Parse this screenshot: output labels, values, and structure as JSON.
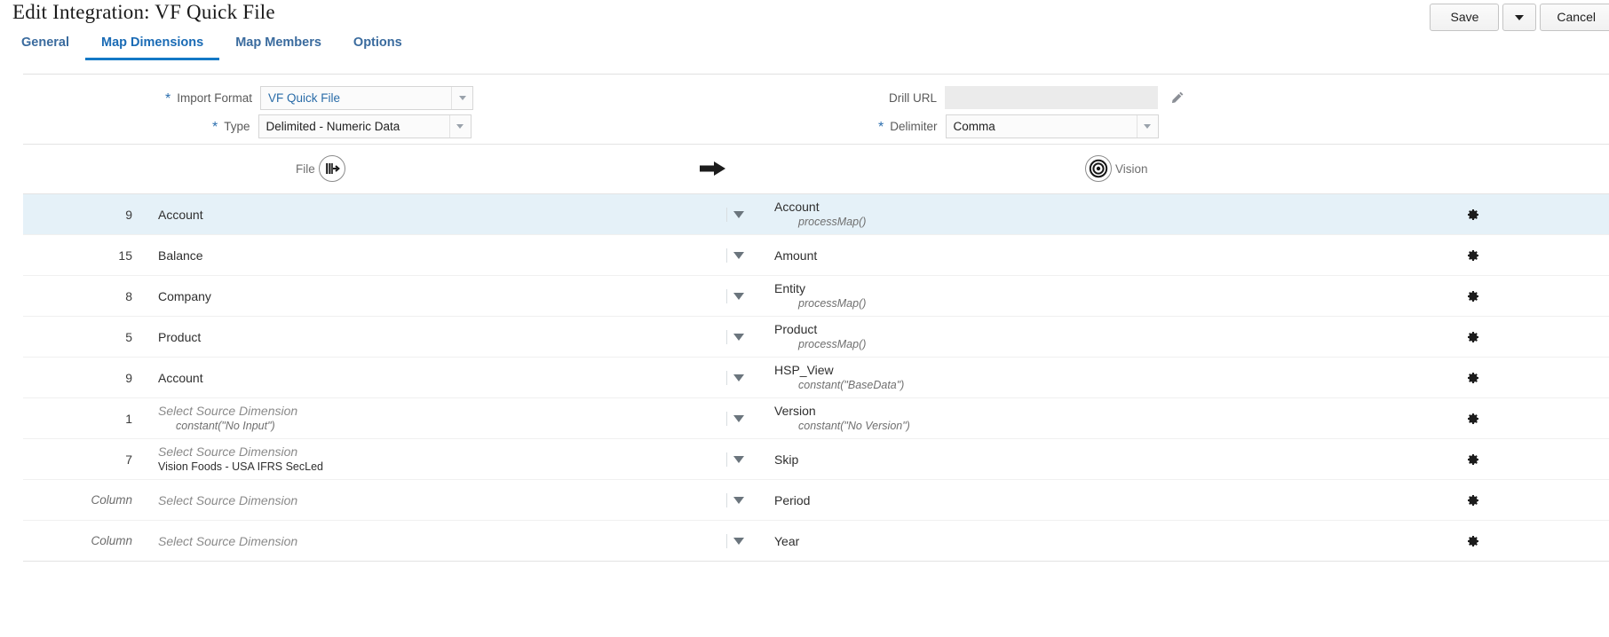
{
  "header": {
    "title": "Edit Integration: VF Quick File",
    "actions": {
      "save_label": "Save",
      "save_menu_icon": "chevron-down-icon",
      "cancel_label": "Cancel"
    }
  },
  "tabs": [
    {
      "label": "General",
      "active": false
    },
    {
      "label": "Map Dimensions",
      "active": true
    },
    {
      "label": "Map Members",
      "active": false
    },
    {
      "label": "Options",
      "active": false
    }
  ],
  "form": {
    "import_format": {
      "label": "Import Format",
      "required": true,
      "value": "VF Quick File",
      "dropdown_icon": "chevron-down-icon"
    },
    "type": {
      "label": "Type",
      "required": true,
      "value": "Delimited - Numeric Data",
      "dropdown_icon": "chevron-down-icon"
    },
    "drill_url": {
      "label": "Drill URL",
      "required": false,
      "value": "",
      "disabled": true,
      "edit_icon": "pencil-icon"
    },
    "delimiter": {
      "label": "Delimiter",
      "required": true,
      "value": "Comma",
      "dropdown_icon": "chevron-down-icon"
    }
  },
  "map_header": {
    "source_label": "File",
    "source_icon": "file-import-icon",
    "direction_icon": "arrow-right-icon",
    "target_label": "Vision",
    "target_icon": "target-bullseye-icon"
  },
  "mapping_rows": [
    {
      "column": "9",
      "column_italic": false,
      "source": "Account",
      "source_placeholder": false,
      "source_sub": "",
      "source_sub_italic": false,
      "target": "Account",
      "target_sub": "processMap()",
      "selected": true,
      "gear_icon": "gear-icon",
      "dropdown_icon": "caret-down-icon"
    },
    {
      "column": "15",
      "column_italic": false,
      "source": "Balance",
      "source_placeholder": false,
      "source_sub": "",
      "source_sub_italic": false,
      "target": "Amount",
      "target_sub": "",
      "selected": false,
      "gear_icon": "gear-icon",
      "dropdown_icon": "caret-down-icon"
    },
    {
      "column": "8",
      "column_italic": false,
      "source": "Company",
      "source_placeholder": false,
      "source_sub": "",
      "source_sub_italic": false,
      "target": "Entity",
      "target_sub": "processMap()",
      "selected": false,
      "gear_icon": "gear-icon",
      "dropdown_icon": "caret-down-icon"
    },
    {
      "column": "5",
      "column_italic": false,
      "source": "Product",
      "source_placeholder": false,
      "source_sub": "",
      "source_sub_italic": false,
      "target": "Product",
      "target_sub": "processMap()",
      "selected": false,
      "gear_icon": "gear-icon",
      "dropdown_icon": "caret-down-icon"
    },
    {
      "column": "9",
      "column_italic": false,
      "source": "Account",
      "source_placeholder": false,
      "source_sub": "",
      "source_sub_italic": false,
      "target": "HSP_View",
      "target_sub": "constant(\"BaseData\")",
      "selected": false,
      "gear_icon": "gear-icon",
      "dropdown_icon": "caret-down-icon"
    },
    {
      "column": "1",
      "column_italic": false,
      "source": "Select Source Dimension",
      "source_placeholder": true,
      "source_sub": "constant(\"No Input\")",
      "source_sub_italic": true,
      "target": "Version",
      "target_sub": "constant(\"No Version\")",
      "selected": false,
      "gear_icon": "gear-icon",
      "dropdown_icon": "caret-down-icon"
    },
    {
      "column": "7",
      "column_italic": false,
      "source": "Select Source Dimension",
      "source_placeholder": true,
      "source_sub": "Vision Foods - USA IFRS SecLed",
      "source_sub_italic": false,
      "target": "Skip",
      "target_sub": "",
      "selected": false,
      "gear_icon": "gear-icon",
      "dropdown_icon": "caret-down-icon"
    },
    {
      "column": "Column",
      "column_italic": true,
      "source": "Select Source Dimension",
      "source_placeholder": true,
      "source_sub": "",
      "source_sub_italic": false,
      "target": "Period",
      "target_sub": "",
      "selected": false,
      "gear_icon": "gear-icon",
      "dropdown_icon": "caret-down-icon"
    },
    {
      "column": "Column",
      "column_italic": true,
      "source": "Select Source Dimension",
      "source_placeholder": true,
      "source_sub": "",
      "source_sub_italic": false,
      "target": "Year",
      "target_sub": "",
      "selected": false,
      "gear_icon": "gear-icon",
      "dropdown_icon": "caret-down-icon"
    }
  ],
  "colors": {
    "accent": "#1379c6",
    "tab_text": "#3a6b9e",
    "row_selected": "#e5f1f8",
    "required_star": "#2c6faf"
  }
}
